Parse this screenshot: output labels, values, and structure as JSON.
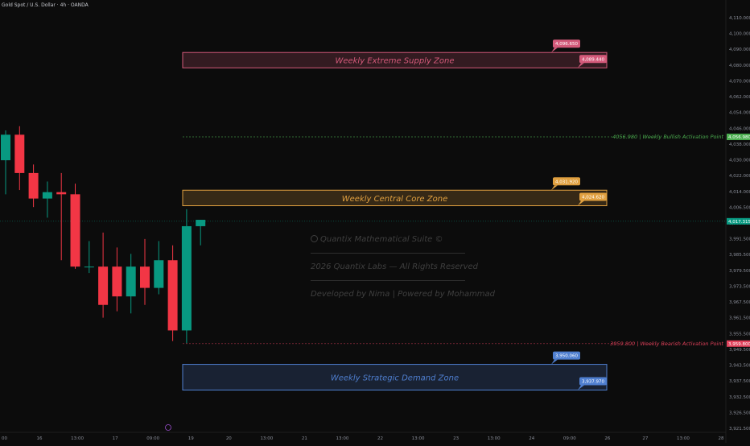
{
  "symbol_title": "Gold Spot / U.S. Dollar · 4h · OANDA",
  "colors": {
    "background": "#0c0c0c",
    "up": "#089981",
    "down": "#f23645",
    "supply": "#d45a7a",
    "core": "#e0a040",
    "demand": "#4f7fd0",
    "bullish": "#4caf50",
    "bearish": "#e0405a",
    "axis_text": "#8a8e99"
  },
  "watermark": {
    "brand": "Quantix Mathematical Suite ©",
    "copyright": "2026 Quantix Labs — All Rights Reserved",
    "credits": "Developed by Nima | Powered by Mohammad"
  },
  "chart_data": {
    "type": "candlestick",
    "ylim": [
      3920,
      4113
    ],
    "y_ticks": [
      "4,110.000",
      "4,100.000",
      "4,090.000",
      "4,080.000",
      "4,070.000",
      "4,062.000",
      "4,054.000",
      "4,046.000",
      "4,038.000",
      "4,030.000",
      "4,022.000",
      "4,014.000",
      "4,006.500",
      "3,999.000",
      "3,991.500",
      "3,985.500",
      "3,979.500",
      "3,973.500",
      "3,967.500",
      "3,961.500",
      "3,955.500",
      "3,949.500",
      "3,943.500",
      "3,937.500",
      "3,932.500",
      "3,926.500",
      "3,921.500"
    ],
    "x_ticks": [
      "00",
      "16",
      "13:00",
      "17",
      "09:00",
      "19",
      "20",
      "13:00",
      "21",
      "13:00",
      "22",
      "13:00",
      "23",
      "13:00",
      "24",
      "09:00",
      "26",
      "27",
      "13:00",
      "28"
    ],
    "candles": [
      {
        "o": 4046,
        "h": 4060,
        "l": 4030,
        "c": 4058
      },
      {
        "o": 4058,
        "h": 4062,
        "l": 4032,
        "c": 4040
      },
      {
        "o": 4040,
        "h": 4044,
        "l": 4024,
        "c": 4028
      },
      {
        "o": 4028,
        "h": 4036,
        "l": 4019,
        "c": 4031
      },
      {
        "o": 4031,
        "h": 4040,
        "l": 3999,
        "c": 4030
      },
      {
        "o": 4030,
        "h": 4035,
        "l": 3995,
        "c": 3996
      },
      {
        "o": 3996,
        "h": 4008,
        "l": 3993,
        "c": 3996
      },
      {
        "o": 3996,
        "h": 4012,
        "l": 3972,
        "c": 3978
      },
      {
        "o": 3996,
        "h": 4005,
        "l": 3975,
        "c": 3982
      },
      {
        "o": 3982,
        "h": 4002,
        "l": 3974,
        "c": 3996
      },
      {
        "o": 3996,
        "h": 4009,
        "l": 3978,
        "c": 3986
      },
      {
        "o": 3986,
        "h": 4008,
        "l": 3983,
        "c": 3999
      },
      {
        "o": 3999,
        "h": 4006,
        "l": 3961,
        "c": 3966
      },
      {
        "o": 3966,
        "h": 4023,
        "l": 3960,
        "c": 4015
      },
      {
        "o": 4015,
        "h": 4018,
        "l": 4006,
        "c": 4018
      }
    ],
    "current_price": "4,017.315",
    "zones": [
      {
        "label": "Weekly Extreme Supply Zone",
        "top": 4096.65,
        "bottom": 4089.44,
        "top_label": "4,096.650",
        "bottom_label": "4,089.440",
        "color": "#d45a7a"
      },
      {
        "label": "Weekly Central Core Zone",
        "top": 4031.92,
        "bottom": 4024.62,
        "top_label": "4,031.920",
        "bottom_label": "4,024.620",
        "color": "#e0a040"
      },
      {
        "label": "Weekly Strategic Demand Zone",
        "top": 3950.06,
        "bottom": 3937.97,
        "top_label": "3,950.060",
        "bottom_label": "3,937.970",
        "color": "#4f7fd0"
      }
    ],
    "levels": [
      {
        "value": 4056.98,
        "text": "4056.980 | Weekly Bullish Activation Point",
        "tag": "4,056.980",
        "color": "#4caf50"
      },
      {
        "value": 3959.8,
        "text": "3959.800 | Weekly Bearish Activation Point",
        "tag": "3,959.800",
        "color": "#e0405a"
      }
    ]
  }
}
